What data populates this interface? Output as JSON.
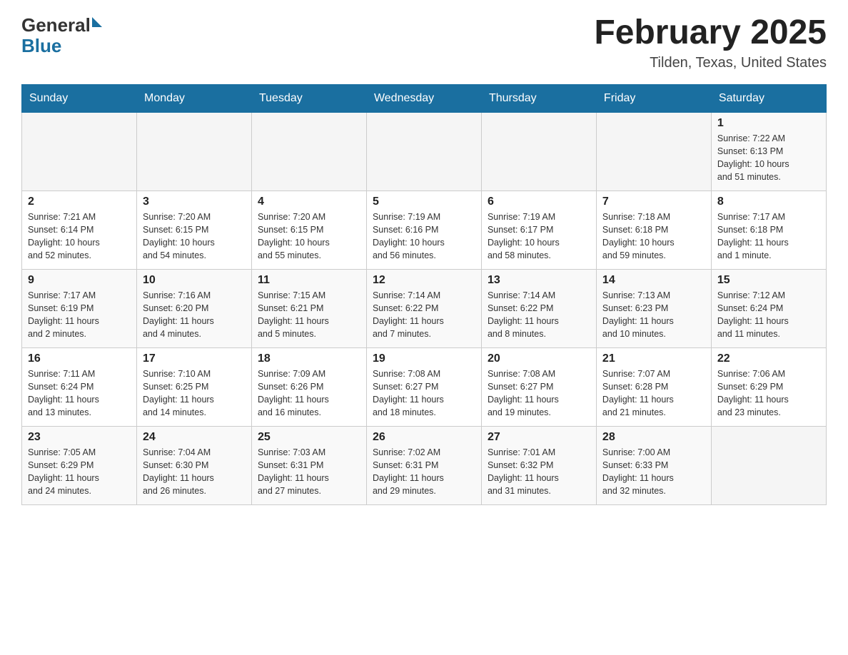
{
  "header": {
    "logo_general": "General",
    "logo_blue": "Blue",
    "title": "February 2025",
    "location": "Tilden, Texas, United States"
  },
  "days_of_week": [
    "Sunday",
    "Monday",
    "Tuesday",
    "Wednesday",
    "Thursday",
    "Friday",
    "Saturday"
  ],
  "weeks": [
    [
      {
        "day": "",
        "info": ""
      },
      {
        "day": "",
        "info": ""
      },
      {
        "day": "",
        "info": ""
      },
      {
        "day": "",
        "info": ""
      },
      {
        "day": "",
        "info": ""
      },
      {
        "day": "",
        "info": ""
      },
      {
        "day": "1",
        "info": "Sunrise: 7:22 AM\nSunset: 6:13 PM\nDaylight: 10 hours\nand 51 minutes."
      }
    ],
    [
      {
        "day": "2",
        "info": "Sunrise: 7:21 AM\nSunset: 6:14 PM\nDaylight: 10 hours\nand 52 minutes."
      },
      {
        "day": "3",
        "info": "Sunrise: 7:20 AM\nSunset: 6:15 PM\nDaylight: 10 hours\nand 54 minutes."
      },
      {
        "day": "4",
        "info": "Sunrise: 7:20 AM\nSunset: 6:15 PM\nDaylight: 10 hours\nand 55 minutes."
      },
      {
        "day": "5",
        "info": "Sunrise: 7:19 AM\nSunset: 6:16 PM\nDaylight: 10 hours\nand 56 minutes."
      },
      {
        "day": "6",
        "info": "Sunrise: 7:19 AM\nSunset: 6:17 PM\nDaylight: 10 hours\nand 58 minutes."
      },
      {
        "day": "7",
        "info": "Sunrise: 7:18 AM\nSunset: 6:18 PM\nDaylight: 10 hours\nand 59 minutes."
      },
      {
        "day": "8",
        "info": "Sunrise: 7:17 AM\nSunset: 6:18 PM\nDaylight: 11 hours\nand 1 minute."
      }
    ],
    [
      {
        "day": "9",
        "info": "Sunrise: 7:17 AM\nSunset: 6:19 PM\nDaylight: 11 hours\nand 2 minutes."
      },
      {
        "day": "10",
        "info": "Sunrise: 7:16 AM\nSunset: 6:20 PM\nDaylight: 11 hours\nand 4 minutes."
      },
      {
        "day": "11",
        "info": "Sunrise: 7:15 AM\nSunset: 6:21 PM\nDaylight: 11 hours\nand 5 minutes."
      },
      {
        "day": "12",
        "info": "Sunrise: 7:14 AM\nSunset: 6:22 PM\nDaylight: 11 hours\nand 7 minutes."
      },
      {
        "day": "13",
        "info": "Sunrise: 7:14 AM\nSunset: 6:22 PM\nDaylight: 11 hours\nand 8 minutes."
      },
      {
        "day": "14",
        "info": "Sunrise: 7:13 AM\nSunset: 6:23 PM\nDaylight: 11 hours\nand 10 minutes."
      },
      {
        "day": "15",
        "info": "Sunrise: 7:12 AM\nSunset: 6:24 PM\nDaylight: 11 hours\nand 11 minutes."
      }
    ],
    [
      {
        "day": "16",
        "info": "Sunrise: 7:11 AM\nSunset: 6:24 PM\nDaylight: 11 hours\nand 13 minutes."
      },
      {
        "day": "17",
        "info": "Sunrise: 7:10 AM\nSunset: 6:25 PM\nDaylight: 11 hours\nand 14 minutes."
      },
      {
        "day": "18",
        "info": "Sunrise: 7:09 AM\nSunset: 6:26 PM\nDaylight: 11 hours\nand 16 minutes."
      },
      {
        "day": "19",
        "info": "Sunrise: 7:08 AM\nSunset: 6:27 PM\nDaylight: 11 hours\nand 18 minutes."
      },
      {
        "day": "20",
        "info": "Sunrise: 7:08 AM\nSunset: 6:27 PM\nDaylight: 11 hours\nand 19 minutes."
      },
      {
        "day": "21",
        "info": "Sunrise: 7:07 AM\nSunset: 6:28 PM\nDaylight: 11 hours\nand 21 minutes."
      },
      {
        "day": "22",
        "info": "Sunrise: 7:06 AM\nSunset: 6:29 PM\nDaylight: 11 hours\nand 23 minutes."
      }
    ],
    [
      {
        "day": "23",
        "info": "Sunrise: 7:05 AM\nSunset: 6:29 PM\nDaylight: 11 hours\nand 24 minutes."
      },
      {
        "day": "24",
        "info": "Sunrise: 7:04 AM\nSunset: 6:30 PM\nDaylight: 11 hours\nand 26 minutes."
      },
      {
        "day": "25",
        "info": "Sunrise: 7:03 AM\nSunset: 6:31 PM\nDaylight: 11 hours\nand 27 minutes."
      },
      {
        "day": "26",
        "info": "Sunrise: 7:02 AM\nSunset: 6:31 PM\nDaylight: 11 hours\nand 29 minutes."
      },
      {
        "day": "27",
        "info": "Sunrise: 7:01 AM\nSunset: 6:32 PM\nDaylight: 11 hours\nand 31 minutes."
      },
      {
        "day": "28",
        "info": "Sunrise: 7:00 AM\nSunset: 6:33 PM\nDaylight: 11 hours\nand 32 minutes."
      },
      {
        "day": "",
        "info": ""
      }
    ]
  ]
}
